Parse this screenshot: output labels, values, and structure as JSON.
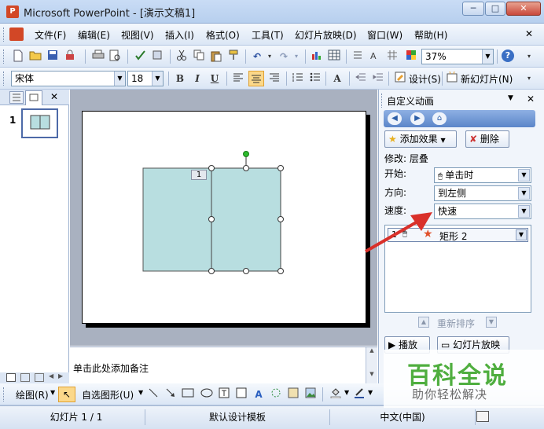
{
  "window": {
    "app_icon": "P",
    "title": "Microsoft PowerPoint - [演示文稿1]",
    "minimize": "─",
    "maximize": "□",
    "close": "✕"
  },
  "menu": [
    "文件(F)",
    "编辑(E)",
    "视图(V)",
    "插入(I)",
    "格式(O)",
    "工具(T)",
    "幻灯片放映(D)",
    "窗口(W)",
    "帮助(H)"
  ],
  "menu_close": "✕",
  "standard_toolbar": {
    "zoom": "37%",
    "help": "?"
  },
  "format_toolbar": {
    "font": "宋体",
    "size": "18",
    "bold": "B",
    "italic": "I",
    "underline": "U",
    "grow_font": "A",
    "design": "设计(S)",
    "new_slide": "新幻灯片(N)"
  },
  "left_panel": {
    "slide_number": "1",
    "close": "✕"
  },
  "slide": {
    "shape_tag": "1"
  },
  "notes": {
    "placeholder": "单击此处添加备注"
  },
  "task_pane": {
    "title": "自定义动画",
    "add_effect": "添加效果",
    "remove": "删除",
    "modify_label": "修改: 层叠",
    "start_label": "开始:",
    "start_value": "单击时",
    "direction_label": "方向:",
    "direction_value": "到左侧",
    "speed_label": "速度:",
    "speed_value": "快速",
    "list_item_number": "1",
    "list_item_name": "矩形 2",
    "reorder": "重新排序",
    "play": "播放",
    "slideshow": "幻灯片放映"
  },
  "draw_toolbar": {
    "draw": "绘图(R)",
    "autoshapes": "自选图形(U)"
  },
  "status": {
    "slide": "幻灯片 1 / 1",
    "template": "默认设计模板",
    "language": "中文(中国)"
  },
  "watermark": {
    "main": "百科全说",
    "sub": "助你轻松解决"
  },
  "colors": {
    "shape_fill": "#b8dee0",
    "accent_arrow": "#d9302a",
    "watermark_green": "#4fae3f"
  }
}
